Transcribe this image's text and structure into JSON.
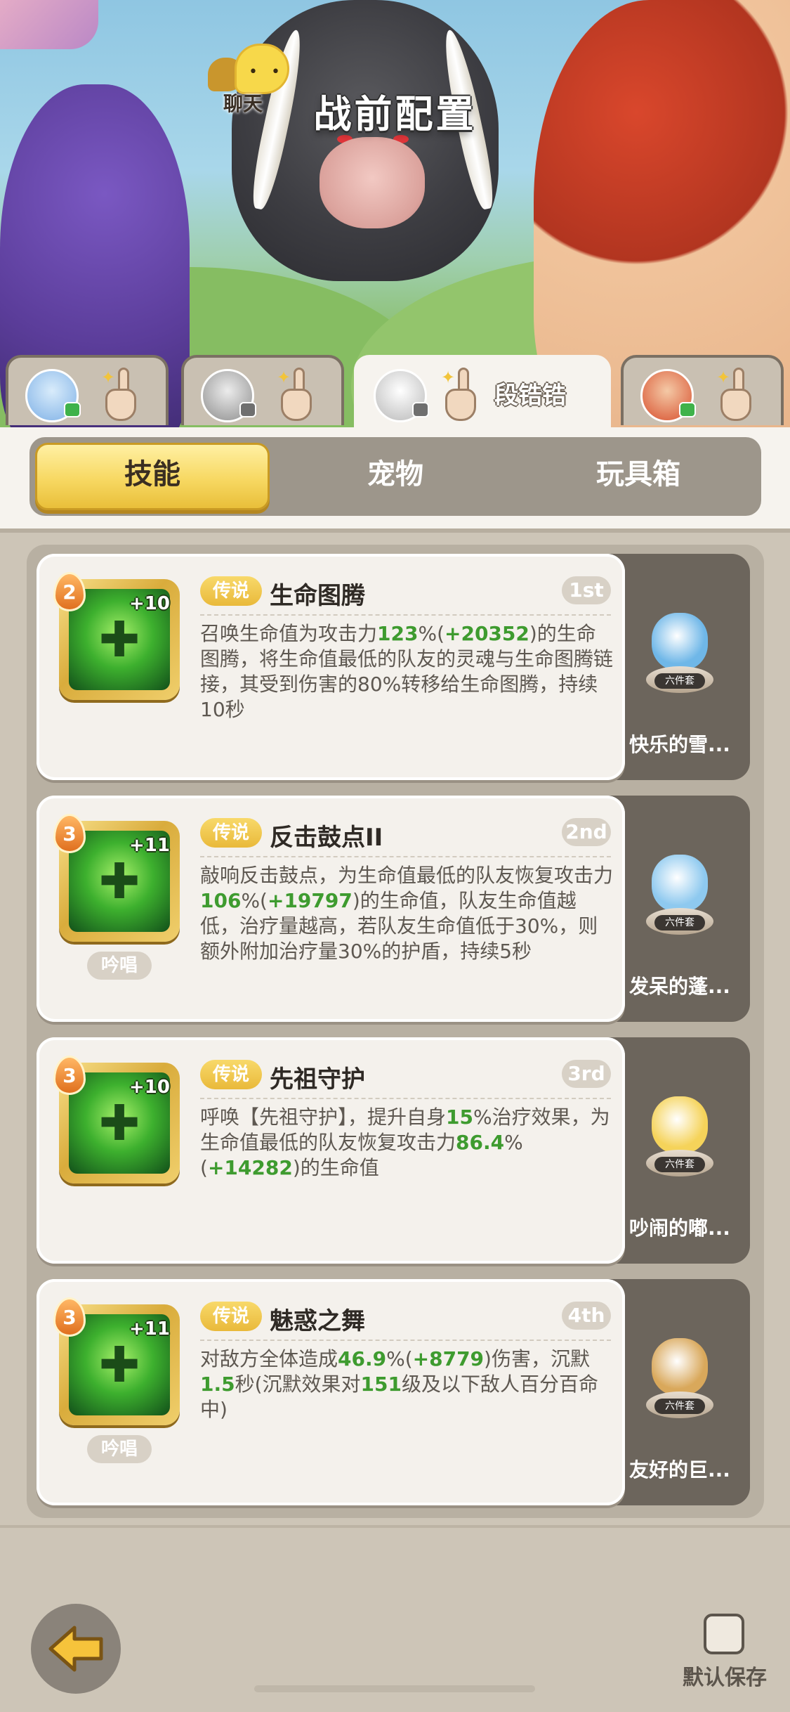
{
  "header": {
    "title": "战前配置",
    "chat_label": "聊天"
  },
  "player_tabs": [
    {
      "name": ""
    },
    {
      "name": ""
    },
    {
      "name": "段锆锆"
    },
    {
      "name": ""
    }
  ],
  "categories": [
    "技能",
    "宠物",
    "玩具箱"
  ],
  "skills": [
    {
      "level": "2",
      "plus": "+10",
      "tag": "传说",
      "name": "生命图腾",
      "rank": "1st",
      "chant": "",
      "desc": [
        {
          "t": "召唤生命值为攻击力"
        },
        {
          "t": "123",
          "g": true
        },
        {
          "t": "%("
        },
        {
          "t": "+20352",
          "g": true
        },
        {
          "t": ")的生命图腾，将生命值最低的队友的灵魂与生命图腾链接，其受到伤害的80%转移给生命图腾，持续10秒"
        }
      ],
      "pet": {
        "name": "快乐的雪...",
        "set": "六件套"
      }
    },
    {
      "level": "3",
      "plus": "+11",
      "tag": "传说",
      "name": "反击鼓点II",
      "rank": "2nd",
      "chant": "吟唱",
      "desc": [
        {
          "t": "敲响反击鼓点，为生命值最低的队友恢复攻击力"
        },
        {
          "t": "106",
          "g": true
        },
        {
          "t": "%("
        },
        {
          "t": "+19797",
          "g": true
        },
        {
          "t": ")的生命值，队友生命值越低，治疗量越高，若队友生命值低于30%，则额外附加治疗量30%的护盾，持续5秒"
        }
      ],
      "pet": {
        "name": "发呆的蓬...",
        "set": "六件套"
      }
    },
    {
      "level": "3",
      "plus": "+10",
      "tag": "传说",
      "name": "先祖守护",
      "rank": "3rd",
      "chant": "",
      "desc": [
        {
          "t": "呼唤【先祖守护】，提升自身"
        },
        {
          "t": "15",
          "g": true
        },
        {
          "t": "%治疗效果，为生命值最低的队友恢复攻击力"
        },
        {
          "t": "86.4",
          "g": true
        },
        {
          "t": "%("
        },
        {
          "t": "+14282",
          "g": true
        },
        {
          "t": ")的生命值"
        }
      ],
      "pet": {
        "name": "吵闹的嘟...",
        "set": "六件套"
      }
    },
    {
      "level": "3",
      "plus": "+11",
      "tag": "传说",
      "name": "魅惑之舞",
      "rank": "4th",
      "chant": "吟唱",
      "desc": [
        {
          "t": "对敌方全体造成"
        },
        {
          "t": "46.9",
          "g": true
        },
        {
          "t": "%("
        },
        {
          "t": "+8779",
          "g": true
        },
        {
          "t": ")伤害，沉默"
        },
        {
          "t": "1.5",
          "g": true
        },
        {
          "t": "秒(沉默效果对"
        },
        {
          "t": "151",
          "g": true
        },
        {
          "t": "级及以下敌人百分百命中)"
        }
      ],
      "pet": {
        "name": "友好的巨...",
        "set": "六件套"
      }
    }
  ],
  "footer": {
    "save_label": "默认保存"
  },
  "colors": {
    "accent_yellow": "#f7d862",
    "highlight_green": "#3e9b2f",
    "card_bg": "#f4f1ec"
  }
}
